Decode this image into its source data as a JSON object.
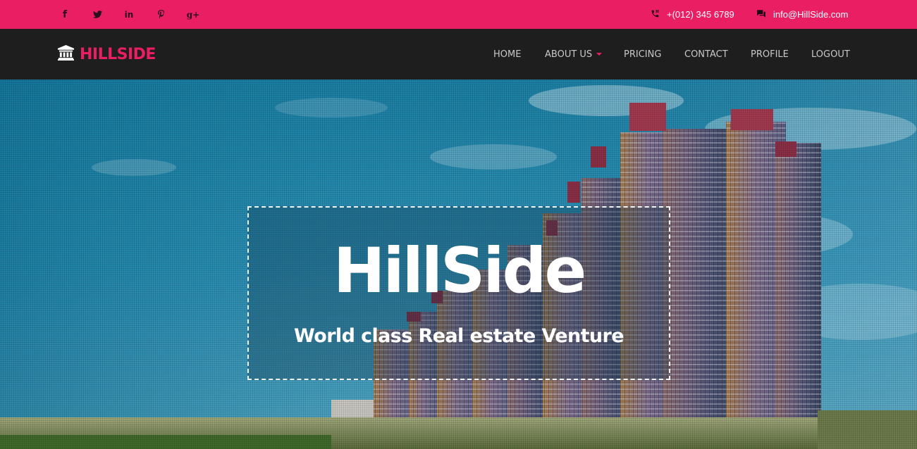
{
  "topbar": {
    "social": [
      {
        "name": "facebook",
        "glyph": "f"
      },
      {
        "name": "twitter",
        "glyph": ""
      },
      {
        "name": "linkedin",
        "glyph": "in"
      },
      {
        "name": "pinterest",
        "glyph": ""
      },
      {
        "name": "google-plus",
        "glyph": "g+"
      }
    ],
    "phone": "+(012) 345 6789",
    "email": "info@HillSide.com",
    "color": "#ea1e63"
  },
  "navbar": {
    "brand": "HILLSIDE",
    "items": [
      {
        "label": "HOME"
      },
      {
        "label": "ABOUT US"
      },
      {
        "label": "PRICING"
      },
      {
        "label": "CONTACT"
      },
      {
        "label": "PROFILE"
      },
      {
        "label": "LOGOUT"
      }
    ],
    "background": "#1e1e1e"
  },
  "hero": {
    "title": "HillSide",
    "subtitle": "World class Real estate Venture"
  }
}
